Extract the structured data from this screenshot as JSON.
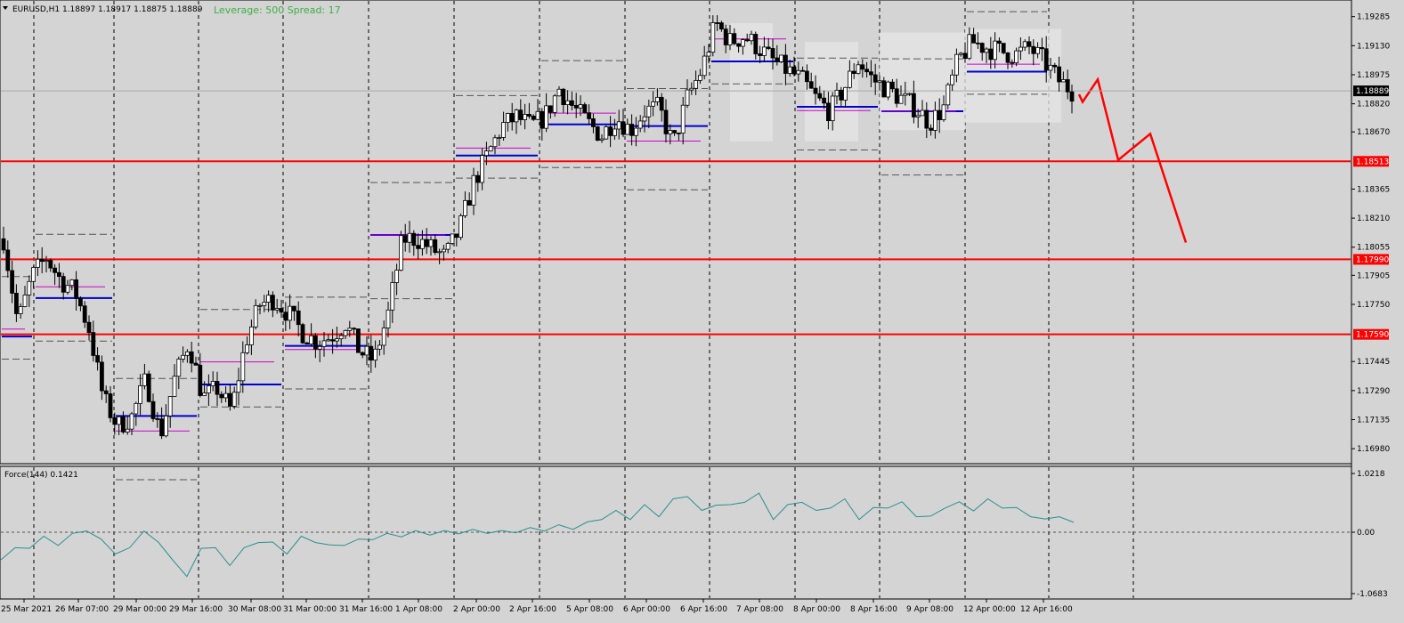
{
  "header": {
    "symbol_info": "EURUSD,H1  1.18897 1.18917 1.18875 1.18889",
    "leverage_info": "Leverage: 500 Spread: 17"
  },
  "indicator": {
    "label": "Force(144) 0.1421"
  },
  "colors": {
    "background": "#d4d4d4",
    "bull_candle": "#ffffff",
    "bear_candle": "#000000",
    "level_line": "#ff0000",
    "blue_level": "#0000cc",
    "magenta_level": "#cc00cc",
    "indicator_line": "#2a8f8f",
    "leverage_text": "#3cb043",
    "projection": "#ff0000"
  },
  "chart_data": [
    {
      "type": "candlestick",
      "title": "EURUSD,H1",
      "ohlc_last": {
        "open": 1.18897,
        "high": 1.18917,
        "low": 1.18875,
        "close": 1.18889
      },
      "ylim": [
        1.169,
        1.1935
      ],
      "y_ticks": [
        "1.19285",
        "1.19130",
        "1.18975",
        "1.18820",
        "1.18670",
        "1.18365",
        "1.18210",
        "1.18055",
        "1.17905",
        "1.17750",
        "1.17445",
        "1.17290",
        "1.17135",
        "1.16980"
      ],
      "current_price": "1.18889",
      "levels": [
        {
          "value": 1.18513,
          "label": "1.18513"
        },
        {
          "value": 1.1799,
          "label": "1.17990"
        },
        {
          "value": 1.1759,
          "label": "1.17590"
        }
      ],
      "x_tick_labels": [
        "25 Mar 2021",
        "26 Mar 07:00",
        "29 Mar 00:00",
        "29 Mar 16:00",
        "30 Mar 08:00",
        "31 Mar 00:00",
        "31 Mar 16:00",
        "1 Apr 08:00",
        "2 Apr 00:00",
        "2 Apr 16:00",
        "5 Apr 08:00",
        "6 Apr 00:00",
        "6 Apr 16:00",
        "7 Apr 08:00",
        "8 Apr 00:00",
        "8 Apr 16:00",
        "9 Apr 08:00",
        "12 Apr 00:00",
        "12 Apr 16:00"
      ],
      "close_path": [
        [
          0,
          1.181
        ],
        [
          1,
          1.1765
        ],
        [
          2,
          1.179
        ],
        [
          3,
          1.18
        ],
        [
          4,
          1.1788
        ],
        [
          5,
          1.1782
        ],
        [
          6,
          1.1762
        ],
        [
          7,
          1.1725
        ],
        [
          8,
          1.171
        ],
        [
          9,
          1.1715
        ],
        [
          10,
          1.1735
        ],
        [
          11,
          1.1705
        ],
        [
          12,
          1.1735
        ],
        [
          13,
          1.1755
        ],
        [
          14,
          1.1725
        ],
        [
          15,
          1.173
        ],
        [
          16,
          1.1718
        ],
        [
          17,
          1.1755
        ],
        [
          18,
          1.1775
        ],
        [
          19,
          1.1778
        ],
        [
          20,
          1.177
        ],
        [
          21,
          1.176
        ],
        [
          22,
          1.1755
        ],
        [
          23,
          1.1758
        ],
        [
          24,
          1.1765
        ],
        [
          25,
          1.175
        ],
        [
          26,
          1.1745
        ],
        [
          27,
          1.177
        ],
        [
          28,
          1.181
        ],
        [
          29,
          1.181
        ],
        [
          30,
          1.1805
        ],
        [
          31,
          1.18
        ],
        [
          32,
          1.1815
        ],
        [
          33,
          1.184
        ],
        [
          34,
          1.1855
        ],
        [
          35,
          1.187
        ],
        [
          36,
          1.1875
        ],
        [
          37,
          1.187
        ],
        [
          38,
          1.1875
        ],
        [
          39,
          1.189
        ],
        [
          40,
          1.188
        ],
        [
          41,
          1.1872
        ],
        [
          42,
          1.1865
        ],
        [
          43,
          1.1875
        ],
        [
          44,
          1.1868
        ],
        [
          45,
          1.1878
        ],
        [
          46,
          1.188
        ],
        [
          47,
          1.186
        ],
        [
          48,
          1.1885
        ],
        [
          49,
          1.19
        ],
        [
          50,
          1.1925
        ],
        [
          51,
          1.1915
        ],
        [
          52,
          1.1918
        ],
        [
          53,
          1.1912
        ],
        [
          54,
          1.1905
        ],
        [
          55,
          1.19
        ],
        [
          56,
          1.1895
        ],
        [
          57,
          1.1885
        ],
        [
          58,
          1.1878
        ],
        [
          59,
          1.189
        ],
        [
          60,
          1.1905
        ],
        [
          61,
          1.1895
        ],
        [
          62,
          1.189
        ],
        [
          63,
          1.1885
        ],
        [
          64,
          1.188
        ],
        [
          65,
          1.1872
        ],
        [
          66,
          1.188
        ],
        [
          67,
          1.1905
        ],
        [
          68,
          1.1915
        ],
        [
          69,
          1.1912
        ],
        [
          70,
          1.191
        ],
        [
          71,
          1.1908
        ],
        [
          72,
          1.1912
        ],
        [
          73,
          1.1905
        ],
        [
          74,
          1.1895
        ],
        [
          75,
          1.1889
        ]
      ],
      "projection": [
        [
          1.1885,
          1.1883
        ],
        [
          1.1888,
          1.1895
        ],
        [
          1.1885,
          1.1852
        ],
        [
          1.1888,
          1.1866
        ],
        [
          1.1885,
          1.1808
        ]
      ]
    },
    {
      "type": "line",
      "title": "Force(144) 0.1421",
      "ylim": [
        -1.0683,
        1.0218
      ],
      "y_ticks": [
        "1.0218",
        "0.00",
        "-1.0683"
      ],
      "series": [
        {
          "name": "Force(144)",
          "values": [
            -0.45,
            -0.3,
            -0.25,
            -0.1,
            -0.2,
            -0.05,
            0.05,
            -0.15,
            -0.35,
            -0.3,
            0.05,
            -0.2,
            -0.45,
            -0.8,
            -0.25,
            -0.3,
            -0.55,
            -0.3,
            -0.15,
            -0.2,
            -0.35,
            -0.1,
            -0.15,
            -0.25,
            -0.2,
            -0.15,
            -0.1,
            -0.05,
            -0.05,
            0.0,
            -0.02,
            0.0,
            0.0,
            0.02,
            0.01,
            0.0,
            0.02,
            0.05,
            0.05,
            0.1,
            0.08,
            0.15,
            0.25,
            0.35,
            0.25,
            0.45,
            0.3,
            0.55,
            0.65,
            0.35,
            0.5,
            0.45,
            0.55,
            0.65,
            0.25,
            0.45,
            0.55,
            0.35,
            0.45,
            0.55,
            0.25,
            0.4,
            0.45,
            0.5,
            0.3,
            0.25,
            0.45,
            0.5,
            0.4,
            0.55,
            0.45,
            0.4,
            0.3,
            0.2,
            0.3,
            0.1421
          ]
        }
      ]
    }
  ]
}
